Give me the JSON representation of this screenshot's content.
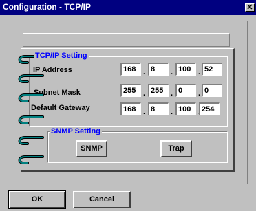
{
  "window": {
    "title": "Configuration - TCP/IP",
    "close_label": "✕"
  },
  "tcpip": {
    "group_title": "TCP/IP Setting",
    "rows": [
      {
        "label": "IP Address",
        "values": [
          "168",
          "8",
          "100",
          "52"
        ]
      },
      {
        "label": "Subnet Mask",
        "values": [
          "255",
          "255",
          "0",
          "0"
        ]
      },
      {
        "label": "Default Gateway",
        "values": [
          "168",
          "8",
          "100",
          "254"
        ]
      }
    ],
    "separator": "."
  },
  "snmp": {
    "group_title": "SNMP Setting",
    "snmp_button": "SNMP",
    "trap_button": "Trap"
  },
  "footer": {
    "ok_label": "OK",
    "cancel_label": "Cancel"
  },
  "colors": {
    "title_bg": "#000080",
    "group_title": "#0000ff",
    "ring": "#008080",
    "face": "#c0c0c0"
  },
  "icons": {
    "binder_ring": "binder-ring-icon"
  }
}
